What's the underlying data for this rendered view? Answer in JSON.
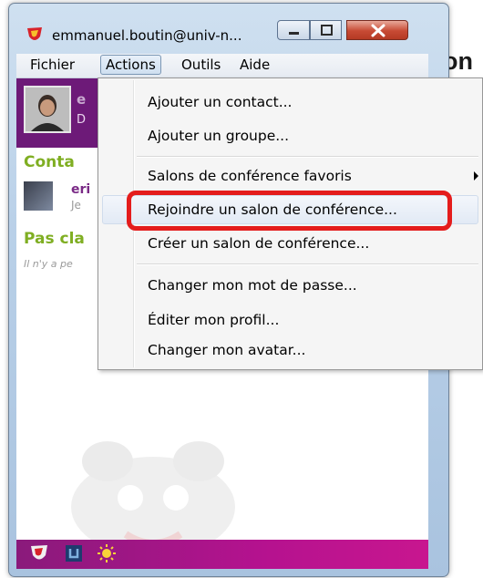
{
  "background": {
    "heading_fragment": "on"
  },
  "window": {
    "title": "emmanuel.boutin@univ-n...",
    "controls": {
      "minimize": "minimize-icon",
      "maximize": "maximize-icon",
      "close": "close-icon"
    }
  },
  "menubar": {
    "items": [
      "Fichier",
      "Actions",
      "Outils",
      "Aide"
    ],
    "active": "Actions"
  },
  "profile": {
    "name": "e",
    "status": "D"
  },
  "contacts": {
    "section_title": "Conta",
    "items": [
      {
        "name": "eri",
        "status": "Je"
      }
    ]
  },
  "unclassified": {
    "section_title": "Pas cla",
    "empty_text": "Il n'y a pe"
  },
  "actions_menu": {
    "items": [
      {
        "label": "Ajouter un contact..."
      },
      {
        "label": "Ajouter un groupe..."
      },
      {
        "label": "Salons de conférence favoris",
        "submenu": true
      },
      {
        "label": "Rejoindre un salon de conférence...",
        "highlighted": true
      },
      {
        "label": "Créer un salon de conférence..."
      },
      {
        "label": "Changer mon mot de passe..."
      },
      {
        "label": "Éditer mon profil..."
      },
      {
        "label": "Changer mon avatar..."
      }
    ]
  },
  "colors": {
    "profile_bg": "#6d1a78",
    "section_green": "#7fae22",
    "highlight_box": "#e41c1c"
  }
}
